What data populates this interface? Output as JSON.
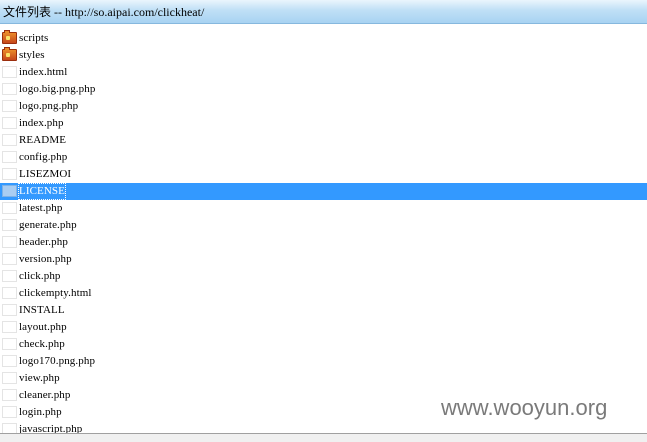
{
  "window": {
    "title": "文件列表 -- http://so.aipai.com/clickheat/"
  },
  "files": [
    {
      "name": "scripts",
      "type": "folder",
      "icon": "folder-icon"
    },
    {
      "name": "styles",
      "type": "folder",
      "icon": "folder-icon"
    },
    {
      "name": "index.html",
      "type": "file",
      "icon": "file-icon"
    },
    {
      "name": "logo.big.png.php",
      "type": "file",
      "icon": "file-icon"
    },
    {
      "name": "logo.png.php",
      "type": "file",
      "icon": "file-icon"
    },
    {
      "name": "index.php",
      "type": "file",
      "icon": "file-icon"
    },
    {
      "name": "README",
      "type": "file",
      "icon": "file-icon"
    },
    {
      "name": "config.php",
      "type": "file",
      "icon": "file-icon"
    },
    {
      "name": "LISEZMOI",
      "type": "file",
      "icon": "file-icon"
    },
    {
      "name": "LICENSE",
      "type": "file",
      "icon": "file-icon",
      "selected": true
    },
    {
      "name": "latest.php",
      "type": "file",
      "icon": "file-icon"
    },
    {
      "name": "generate.php",
      "type": "file",
      "icon": "file-icon"
    },
    {
      "name": "header.php",
      "type": "file",
      "icon": "file-icon"
    },
    {
      "name": "version.php",
      "type": "file",
      "icon": "file-icon"
    },
    {
      "name": "click.php",
      "type": "file",
      "icon": "file-icon"
    },
    {
      "name": "clickempty.html",
      "type": "file",
      "icon": "file-icon"
    },
    {
      "name": "INSTALL",
      "type": "file",
      "icon": "file-icon"
    },
    {
      "name": "layout.php",
      "type": "file",
      "icon": "file-icon"
    },
    {
      "name": "check.php",
      "type": "file",
      "icon": "file-icon"
    },
    {
      "name": "logo170.png.php",
      "type": "file",
      "icon": "file-icon"
    },
    {
      "name": "view.php",
      "type": "file",
      "icon": "file-icon"
    },
    {
      "name": "cleaner.php",
      "type": "file",
      "icon": "file-icon"
    },
    {
      "name": "login.php",
      "type": "file",
      "icon": "file-icon"
    },
    {
      "name": "javascript.php",
      "type": "file",
      "icon": "file-icon"
    }
  ],
  "watermark": "www.wooyun.org",
  "colors": {
    "selection": "#3399ff",
    "title_bar": "#bfdff6",
    "folder": "#e98a2a"
  }
}
